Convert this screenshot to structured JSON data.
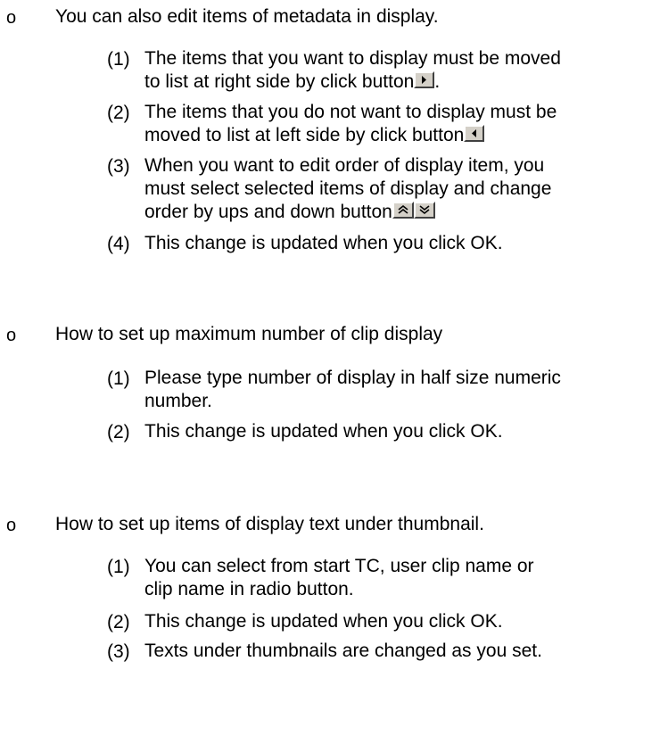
{
  "sections": [
    {
      "bullet": "o",
      "heading": "You can also edit items of metadata in display.",
      "items": [
        {
          "num": "(1)",
          "line1": "The items that you want to display must be moved",
          "line2": "to list at right side by click button",
          "line2_after": "."
        },
        {
          "num": "(2)",
          "line1": "The items that you do not want to display must be",
          "line2": "moved to list at left side by click button"
        },
        {
          "num": "(3)",
          "line1": "When you want to edit order of display item, you",
          "line2": "must select selected items of display and change",
          "line3": "order by ups and down button"
        },
        {
          "num": "(4)",
          "line1": "This change is updated when you click OK."
        }
      ]
    },
    {
      "bullet": "o",
      "heading": "How to set up maximum number of clip display",
      "items": [
        {
          "num": "(1)",
          "line1": "Please type number of display in half size numeric",
          "line2": "number."
        },
        {
          "num": "(2)",
          "line1": "This change is updated when you click OK."
        }
      ]
    },
    {
      "bullet": "o",
      "heading": "How to set up items of display text under thumbnail.",
      "items": [
        {
          "num": "(1)",
          "line1": "You can select from start TC, user clip name or",
          "line2": "clip name in radio button."
        },
        {
          "num": "(2)",
          "line1": "This change is updated when you click OK."
        },
        {
          "num": "(3)",
          "line1": "Texts under thumbnails are changed as you set."
        }
      ]
    }
  ],
  "icons": {
    "move_right": "move-right-arrow-icon",
    "move_left": "move-left-arrow-icon",
    "move_up": "move-up-double-chevron-icon",
    "move_down": "move-down-double-chevron-icon"
  },
  "colors": {
    "text": "#000000",
    "button_face": "#d4d0c8"
  }
}
